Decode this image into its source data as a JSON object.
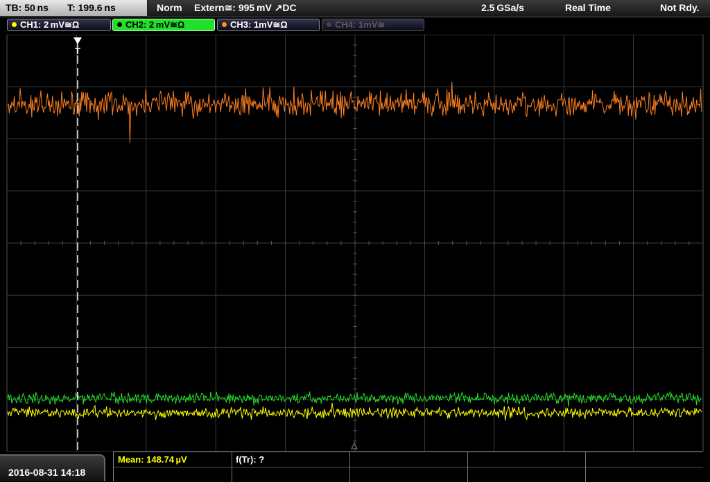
{
  "topbar": {
    "timebase": "TB: 50 ns",
    "trigger_time": "T: 199.6 ns",
    "mode": "Norm",
    "trigger_source": "Extern≅: 995 mV ↗DC",
    "sample_rate": "2.5 GSa/s",
    "acq_mode": "Real Time",
    "status": "Not Rdy."
  },
  "channels": [
    {
      "label": "CH1: 2 mV≅Ω",
      "color": "#ffff00"
    },
    {
      "label": "CH2: 2 mV≅Ω",
      "color": "#22e02a"
    },
    {
      "label": "CH3: 1mV≅Ω",
      "color": "#ff8c2a"
    },
    {
      "label": "CH4: 1mV≅",
      "color": "#555555"
    }
  ],
  "trigger_marker": "T",
  "colors": {
    "ch1": "#ffff00",
    "ch2": "#22e02a",
    "ch3": "#ff8020",
    "grid": "#3c3c3c"
  },
  "bottombar": {
    "datetime": "2016-08-31 14:18",
    "measurement_mean": "Mean: 148.74 µV",
    "measurement_freq": "f(Tr): ?"
  }
}
